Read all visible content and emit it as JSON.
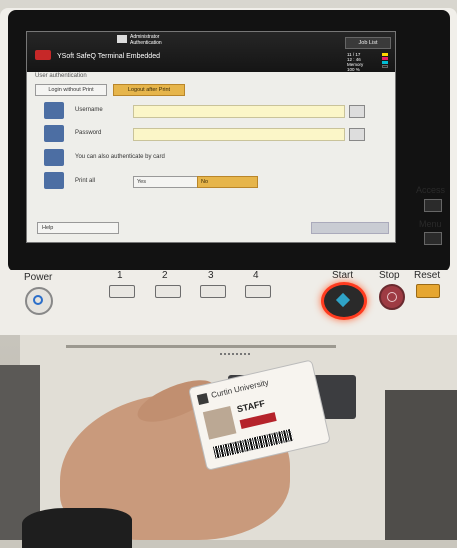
{
  "screen": {
    "header": {
      "brand": "YSoft SafeQ Terminal Embedded",
      "admin_line1": "Administrator",
      "admin_line2": "Authentication",
      "job_list_label": "Job List",
      "date_line": "11 / 17",
      "time_line": "12 : 46",
      "memory_label": "Memory",
      "memory_value": "100 %"
    },
    "auth": {
      "section_title": "User authentication",
      "login_without_print": "Login without Print",
      "logout_after_print": "Logout after Print",
      "username_label": "Username",
      "username_value": "",
      "password_label": "Password",
      "password_value": "",
      "card_hint": "You can also authenticate by card",
      "print_all_label": "Print all",
      "yes_label": "Yes",
      "no_label": "No",
      "help_label": "Help",
      "ok_label": ""
    }
  },
  "panel": {
    "power_label": "Power",
    "numbers": [
      "1",
      "2",
      "3",
      "4"
    ],
    "start_label": "Start",
    "stop_label": "Stop",
    "reset_label": "Reset",
    "access_label": "Access",
    "menu_label": "Menu"
  },
  "card": {
    "university": "Curtin University",
    "role": "STAFF"
  },
  "colors": {
    "accent_orange": "#e6b54b",
    "field_yellow": "#fbf6c8",
    "start_ring": "#ff3b1f",
    "icon_blue": "#4c6ea3"
  }
}
